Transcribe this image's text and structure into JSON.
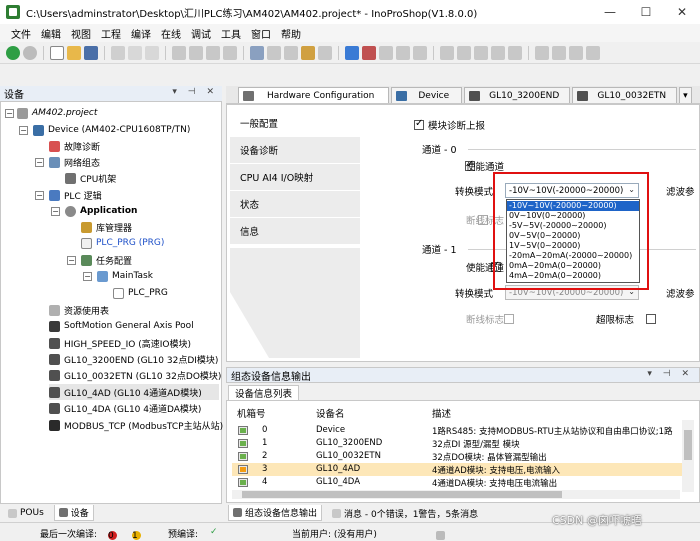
{
  "window": {
    "title": "C:\\Users\\adminstrator\\Desktop\\汇川PLC练习\\AM402\\AM402.project* - InoProShop(V1.8.0.0)",
    "controls": [
      "—",
      "☐",
      "✕"
    ]
  },
  "menu": [
    "文件",
    "编辑",
    "视图",
    "工程",
    "编译",
    "在线",
    "调试",
    "工具",
    "窗口",
    "帮助"
  ],
  "device_panel": {
    "title": "设备",
    "pins": "▾ ⊣ ✕",
    "tree": [
      {
        "label": "AM402.project",
        "icon": "project-icon"
      },
      {
        "label": "Device (AM402-CPU1608TP/TN)",
        "icon": "device-icon"
      },
      {
        "label": "故障诊断",
        "icon": "diagnosis-icon"
      },
      {
        "label": "网络组态",
        "icon": "network-icon"
      },
      {
        "label": "CPU机架",
        "icon": "rack-icon"
      },
      {
        "label": "PLC 逻辑",
        "icon": "plc-logic-icon"
      },
      {
        "label": "Application",
        "icon": "application-icon"
      },
      {
        "label": "库管理器",
        "icon": "library-icon"
      },
      {
        "label": "PLC_PRG (PRG)",
        "icon": "pou-icon"
      },
      {
        "label": "任务配置",
        "icon": "task-config-icon"
      },
      {
        "label": "MainTask",
        "icon": "task-icon"
      },
      {
        "label": "PLC_PRG",
        "icon": "program-call-icon"
      },
      {
        "label": "资源使用表",
        "icon": "resource-icon"
      },
      {
        "label": "SoftMotion General Axis Pool",
        "icon": "axis-pool-icon"
      },
      {
        "label": "HIGH_SPEED_IO (高速IO模块)",
        "icon": "io-module-icon"
      },
      {
        "label": "GL10_3200END (GL10 32点DI模块)",
        "icon": "io-module-icon"
      },
      {
        "label": "GL10_0032ETN (GL10 32点DO模块)",
        "icon": "io-module-icon"
      },
      {
        "label": "GL10_4AD (GL10 4通道AD模块)",
        "icon": "io-module-icon"
      },
      {
        "label": "GL10_4DA (GL10 4通道DA模块)",
        "icon": "io-module-icon"
      },
      {
        "label": "MODBUS_TCP (ModbusTCP主站从站)",
        "icon": "modbus-icon"
      }
    ],
    "bottom_tabs": [
      "POUs",
      "设备"
    ]
  },
  "doc_tabs": [
    "Hardware Configuration",
    "Device",
    "GL10_3200END",
    "GL10_0032ETN",
    "▾"
  ],
  "config": {
    "nav": [
      "一般配置",
      "设备诊断",
      "CPU AI4 I/O映射",
      "状态",
      "信息"
    ],
    "module_diag": "模块诊断上报",
    "channel0": {
      "title": "通道 - 0",
      "enable": "使能通道",
      "mode_label": "转换模式",
      "mode_value": "-10V~10V(-20000~20000)",
      "filter_label": "滤波参",
      "broken_wire": "断线标志"
    },
    "channel1": {
      "title": "通道 - 1",
      "enable": "使能通道",
      "mode_label": "转换模式",
      "mode_value": "-10V~10V(-20000~20000)",
      "filter_label": "滤波参",
      "broken_wire": "断线标志",
      "over_range": "超限标志"
    },
    "dropdown_options": [
      "-10V~10V(-20000~20000)",
      "0V~10V(0~20000)",
      "-5V~5V(-20000~20000)",
      "0V~5V(0~20000)",
      "1V~5V(0~20000)",
      "-20mA~20mA(-20000~20000)",
      "0mA~20mA(0~20000)",
      "4mA~20mA(0~20000)"
    ]
  },
  "bottom_panel": {
    "title": "组态设备信息输出",
    "pins": "▾ ⊣ ✕",
    "subtab": "设备信息列表",
    "columns": [
      "机箱号",
      "设备名",
      "描述"
    ],
    "rows": [
      {
        "index": "0",
        "name": "Device",
        "desc": "1路RS485: 支持MODBUS-RTU主从站协议和自由串口协议;1路"
      },
      {
        "index": "1",
        "name": "GL10_3200END",
        "desc": "32点DI 源型/漏型 模块"
      },
      {
        "index": "2",
        "name": "GL10_0032ETN",
        "desc": "32点DO模块: 晶体管漏型输出"
      },
      {
        "index": "3",
        "name": "GL10_4AD",
        "desc": "4通道AD模块: 支持电压,电流输入"
      },
      {
        "index": "4",
        "name": "GL10_4DA",
        "desc": "4通道DA模块: 支持电压电流输出"
      }
    ],
    "tabs": [
      "组态设备信息输出",
      "消息 - 0个错误，1警告，5条消息"
    ]
  },
  "status": {
    "last_compile": "最后一次编译:",
    "errors": "0",
    "warnings": "1",
    "precompile": "预编译:",
    "current_user": "当前用户: (没有用户)"
  },
  "watermark": "CSDN @囟吓唬晤",
  "colors": {
    "accent": "#1e64c8",
    "highlight": "#fde7b8",
    "callout": "#e01010"
  }
}
